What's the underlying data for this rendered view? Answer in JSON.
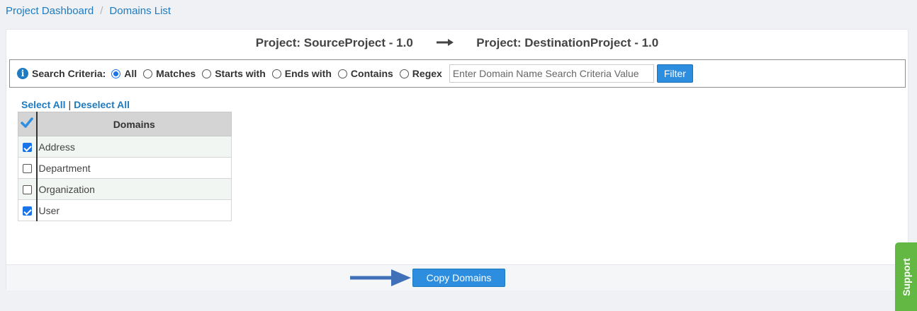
{
  "breadcrumb": {
    "items": [
      "Project Dashboard",
      "Domains List"
    ],
    "separator": "/"
  },
  "header": {
    "source": "Project: SourceProject - 1.0",
    "destination": "Project: DestinationProject - 1.0",
    "arrow_icon": "long-right-arrow-icon"
  },
  "search": {
    "label": "Search Criteria:",
    "options": [
      {
        "label": "All",
        "checked": true
      },
      {
        "label": "Matches",
        "checked": false
      },
      {
        "label": "Starts with",
        "checked": false
      },
      {
        "label": "Ends with",
        "checked": false
      },
      {
        "label": "Contains",
        "checked": false
      },
      {
        "label": "Regex",
        "checked": false
      }
    ],
    "value": "",
    "placeholder": "Enter Domain Name Search Criteria Value",
    "filter_label": "Filter"
  },
  "selection": {
    "select_all": "Select All",
    "separator": "|",
    "deselect_all": "Deselect All"
  },
  "table": {
    "header_check_icon": "checkmark-icon",
    "column": "Domains",
    "rows": [
      {
        "name": "Address",
        "checked": true
      },
      {
        "name": "Department",
        "checked": false
      },
      {
        "name": "Organization",
        "checked": false
      },
      {
        "name": "User",
        "checked": true
      }
    ]
  },
  "footer": {
    "copy_label": "Copy Domains",
    "arrow_icon": "pointer-arrow-icon"
  },
  "support_label": "Support",
  "colors": {
    "link": "#1f7bc1",
    "button": "#2d8ee0",
    "support": "#63b844",
    "checked": "#1a73e8"
  }
}
